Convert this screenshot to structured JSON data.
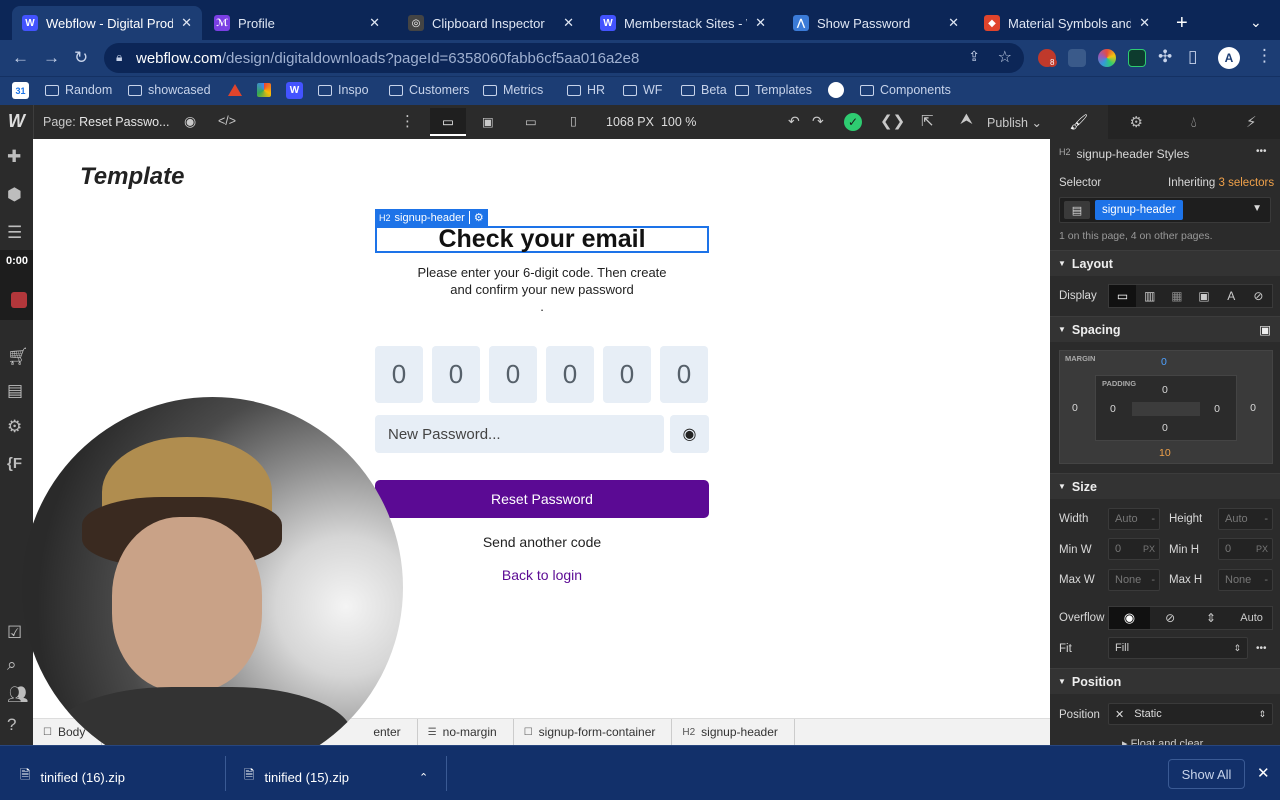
{
  "tabs": [
    {
      "title": "Webflow - Digital Produc",
      "fav": "W",
      "color": "#4353ff",
      "active": true
    },
    {
      "title": "Profile",
      "fav": "ℳ",
      "color": "#7b3fe4"
    },
    {
      "title": "Clipboard Inspector",
      "fav": "◎",
      "color": "#444"
    },
    {
      "title": "Memberstack Sites - We",
      "fav": "W",
      "color": "#4353ff"
    },
    {
      "title": "Show Password",
      "fav": "⋀",
      "color": "#3b7bd8"
    },
    {
      "title": "Material Symbols and Ic",
      "fav": "◆",
      "color": "#e0442c"
    }
  ],
  "tab_close": "✕",
  "new_tab": "+",
  "url": {
    "domain": "webflow.com",
    "path": "/design/digitaldownloads?pageId=6358060fabb6cf5aa016a2e8"
  },
  "ext_badge": "8",
  "profile_initial": "A",
  "bookmarks": [
    "Random",
    "showcased",
    "Inspo",
    "Customers",
    "Metrics",
    "HR",
    "WF",
    "Beta",
    "Templates",
    "Components"
  ],
  "calendar_day": "31",
  "designer": {
    "page_label": "Page:",
    "page_name": "Reset Passwo...",
    "width": "1068",
    "width_unit": "PX",
    "zoom": "100",
    "zoom_unit": "%",
    "publish": "Publish",
    "recording_time": "0:00"
  },
  "canvas": {
    "logo": "Template",
    "selected_tag": "H2",
    "selected_name": "signup-header",
    "heading": "Check your email",
    "instructions_line1": "Please enter your 6-digit code. Then create",
    "instructions_line2": "and confirm your new password",
    "dot": ".",
    "digits": [
      "0",
      "0",
      "0",
      "0",
      "0",
      "0"
    ],
    "password_placeholder": "New Password...",
    "reset_button": "Reset Password",
    "send_code": "Send another code",
    "back_login": "Back to login",
    "button_color": "#5b0a94"
  },
  "breadcrumbs": [
    {
      "label": "Body",
      "icon": "☐"
    },
    {
      "label": "enter",
      "icon": ""
    },
    {
      "label": "no-margin",
      "icon": "☰"
    },
    {
      "label": "signup-form-container",
      "icon": "☐"
    },
    {
      "label": "signup-header",
      "icon": "H2"
    }
  ],
  "style_panel": {
    "header_tag": "H2",
    "header_title": "signup-header Styles",
    "more": "•••",
    "selector_label": "Selector",
    "inheriting": "Inheriting",
    "inherit_count": "3 selectors",
    "selector_chip": "signup-header",
    "selector_note": "1 on this page, 4 on other pages.",
    "layout": "Layout",
    "display": "Display",
    "spacing": "Spacing",
    "margin_label": "MARGIN",
    "padding_label": "PADDING",
    "margin_top": "0",
    "margin_left": "0",
    "margin_right": "0",
    "margin_bottom": "10",
    "padding_top": "0",
    "padding_left": "0",
    "padding_right": "0",
    "padding_bottom": "0",
    "size": "Size",
    "width_label": "Width",
    "width_val": "Auto",
    "height_label": "Height",
    "height_val": "Auto",
    "minw_label": "Min W",
    "minw_val": "0",
    "minh_label": "Min H",
    "minh_val": "0",
    "px": "PX",
    "maxw_label": "Max W",
    "maxw_val": "None",
    "maxh_label": "Max H",
    "maxh_val": "None",
    "dash": "-",
    "overflow_label": "Overflow",
    "overflow_auto": "Auto",
    "fit_label": "Fit",
    "fit_val": "Fill",
    "position": "Position",
    "position_label": "Position",
    "position_val": "Static",
    "float_clear": "Float and clear"
  },
  "downloads": [
    {
      "name": "tinified (16).zip"
    },
    {
      "name": "tinified (15).zip"
    }
  ],
  "show_all": "Show All"
}
